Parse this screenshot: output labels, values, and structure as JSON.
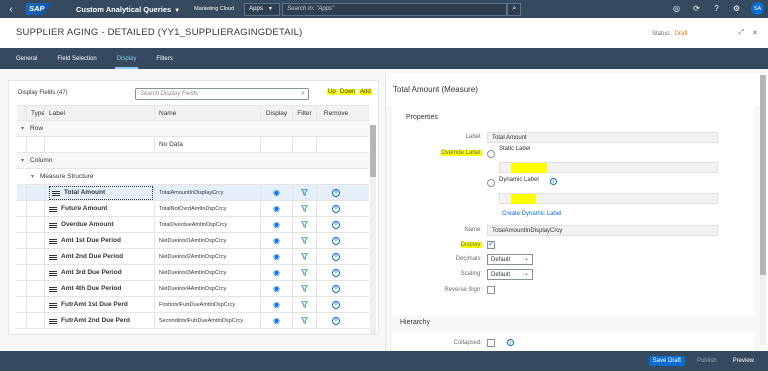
{
  "shell": {
    "logo": "SAP",
    "app_title": "Custom Analytical Queries",
    "subtitle": "Marketing Cloud",
    "scope": "Apps",
    "search_placeholder": "Search In: \"Apps\"",
    "avatar_initials": "SA"
  },
  "header": {
    "title": "SUPPLIER AGING - DETAILED (YY1_SUPPLIERAGINGDETAIL)",
    "status_label": "Status:",
    "status_value": "Draft"
  },
  "tabs": [
    "General",
    "Field Selection",
    "Display",
    "Filters"
  ],
  "active_tab": "Display",
  "left": {
    "fields_count": "Display Fields (47)",
    "search_placeholder": "Search Display Fields",
    "buttons": {
      "up": "Up",
      "down": "Down",
      "add": "Add"
    },
    "columns": {
      "type": "Type",
      "label": "Label",
      "name": "Name",
      "display": "Display",
      "filter": "Filter",
      "remove": "Remove"
    },
    "group_row": "Row",
    "no_data": "No Data",
    "group_column": "Column",
    "subgroup": "Measure Structure",
    "rows": [
      {
        "label": "Total Amount",
        "name": "TotalAmountInDisplayCrcy"
      },
      {
        "label": "Future Amount",
        "name": "TotalNotOvrdAmtInDspCrcy"
      },
      {
        "label": "Overdue Amount",
        "name": "TotalOverdueAmtInDspCrcy"
      },
      {
        "label": "Amt 1st Due Period",
        "name": "NetDueIntvl1AmtInDspCrcy"
      },
      {
        "label": "Amt 2nd Due Period",
        "name": "NetDueIntvl2AmtInDspCrcy"
      },
      {
        "label": "Amt 3rd Due Period",
        "name": "NetDueIntvl3AmtInDspCrcy"
      },
      {
        "label": "Amt 4th Due Period",
        "name": "NetDueIntvl4AmtInDspCrcy"
      },
      {
        "label": "FutrAmt 1st Due Perd",
        "name": "FirstIntvlFutrDueAmtInDspCrcy"
      },
      {
        "label": "FutrAmt 2nd Due Perd",
        "name": "SecondIntvlFutrDueAmtInDspCrcy"
      }
    ]
  },
  "right": {
    "title": "Total Amount (Measure)",
    "properties_title": "Properties",
    "label_label": "Label:",
    "label_value": "Total Amount",
    "override_label": "Override Label:",
    "static_label": "Static Label",
    "dynamic_label": "Dynamic Label",
    "create_dynamic_label": "Create Dynamic Label",
    "name_label": "Name:",
    "name_value": "TotalAmountInDisplayCrcy",
    "display_label": "Display:",
    "display_checked": true,
    "decimals_label": "Decimals:",
    "decimals_value": "Default",
    "scaling_label": "Scaling:",
    "scaling_value": "Default",
    "reverse_sign_label": "Reverse Sign:",
    "hierarchy_title": "Hierarchy",
    "collapsed_label": "Collapsed:"
  },
  "footer": {
    "save_draft": "Save Draft",
    "publish": "Publish",
    "preview": "Preview"
  },
  "colors": {
    "shell": "#354a5f",
    "accent": "#0a6ed1",
    "highlight": "#ffff00",
    "draft": "#e9730c"
  }
}
